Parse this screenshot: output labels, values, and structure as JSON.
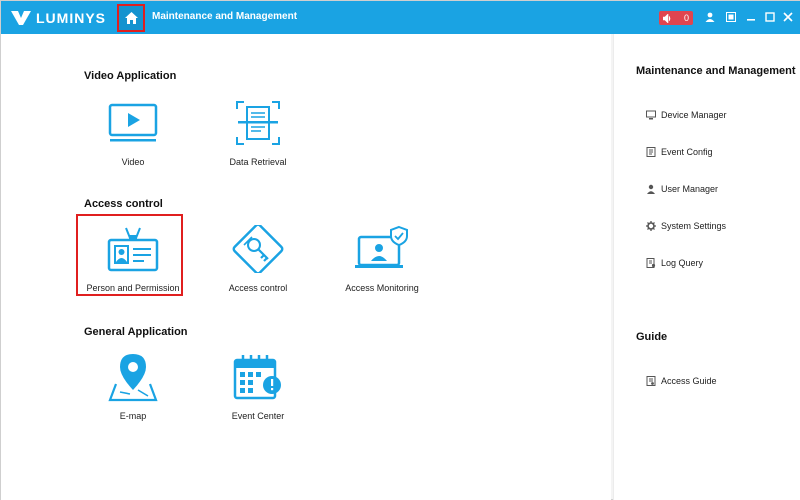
{
  "app": {
    "brand": "LUMINYS",
    "tab_title": "Maintenance and Management"
  },
  "topbar": {
    "alarm_count": "0"
  },
  "sections": {
    "video": {
      "title": "Video Application",
      "items": [
        "Video",
        "Data Retrieval"
      ]
    },
    "access": {
      "title": "Access control",
      "items": [
        "Person and Permission",
        "Access control",
        "Access Monitoring"
      ]
    },
    "general": {
      "title": "General Application",
      "items": [
        "E-map",
        "Event Center"
      ]
    }
  },
  "sidebar": {
    "title": "Maintenance and Management",
    "items": [
      "Device Manager",
      "Event Config",
      "User Manager",
      "System Settings",
      "Log Query"
    ],
    "guide_title": "Guide",
    "guide_items": [
      "Access Guide"
    ]
  },
  "colors": {
    "accent": "#1aa3e3",
    "icon": "#1aa3e3",
    "highlight": "#e01f1f",
    "alarm": "#e0454f"
  }
}
